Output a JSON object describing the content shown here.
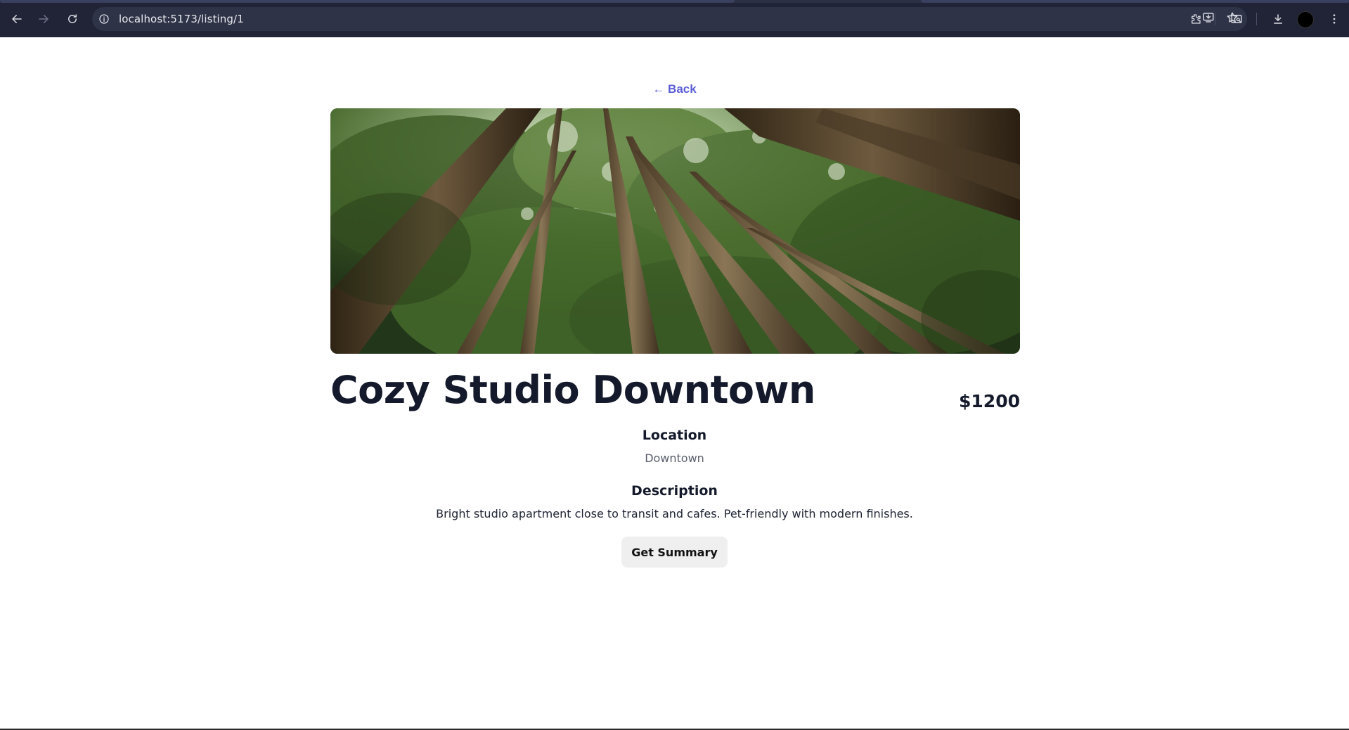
{
  "browser": {
    "url": "localhost:5173/listing/1",
    "accent": "#202436"
  },
  "page": {
    "back_label": "← Back",
    "hero_alt": "Forest canopy looking up at tall trees",
    "title": "Cozy Studio Downtown",
    "price": "$1200",
    "location_heading": "Location",
    "location_value": "Downtown",
    "description_heading": "Description",
    "description_value": "Bright studio apartment close to transit and cafes. Pet-friendly with modern finishes.",
    "summary_button": "Get Summary"
  },
  "colors": {
    "link": "#5b5fd6",
    "heading": "#141a2b",
    "muted": "#5a5f6e",
    "button_bg": "#efefef"
  }
}
